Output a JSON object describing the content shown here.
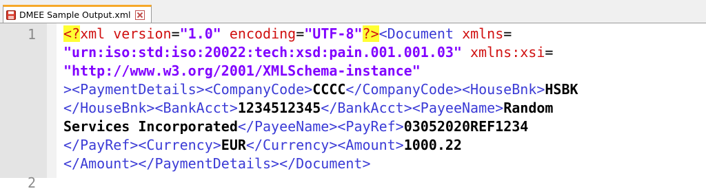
{
  "tab": {
    "title": "DMEE Sample Output.xml",
    "icon": "save-disk-icon",
    "close_icon": "close-icon"
  },
  "gutter": {
    "line_numbers": [
      "1",
      "2"
    ]
  },
  "code": {
    "l1": {
      "pi_open": "<?",
      "pi_name": "xml",
      "sp1": " ",
      "attr_version": "version",
      "eq1": "=",
      "val_version": "\"1.0\"",
      "sp2": " ",
      "attr_encoding": "encoding",
      "eq2": "=",
      "val_encoding": "\"UTF-8\"",
      "pi_close": "?>",
      "doc_open": "<Document",
      "sp3": " ",
      "attr_xmlns": "xmlns",
      "eq3": "="
    },
    "l2": {
      "val_xmlns": "\"urn:iso:std:iso:20022:tech:xsd:pain.001.001.03\"",
      "sp": " ",
      "attr_xsi": "xmlns:xsi",
      "eq": "="
    },
    "l3": {
      "val_xsi": "\"http://www.w3.org/2001/XMLSchema-instance\""
    },
    "l4": {
      "t1": "><PaymentDetails><CompanyCode>",
      "company_code": "CCCC",
      "t2": "</CompanyCode><HouseBnk>",
      "house_bank": "HSBK"
    },
    "l5": {
      "t1": "</HouseBnk><BankAcct>",
      "bank_acct": "1234512345",
      "t2": "</BankAcct><PayeeName>",
      "payee_part1": "Random"
    },
    "l6": {
      "payee_part2": "Services Incorporated",
      "t1": "</PayeeName><PayRef>",
      "pay_ref": "03052020REF1234"
    },
    "l7": {
      "t1": "</PayRef><Currency>",
      "currency": "EUR",
      "t2": "</Currency><Amount>",
      "amount": "1000.22"
    },
    "l8": {
      "t1": "</Amount></PaymentDetails></Document>"
    }
  }
}
